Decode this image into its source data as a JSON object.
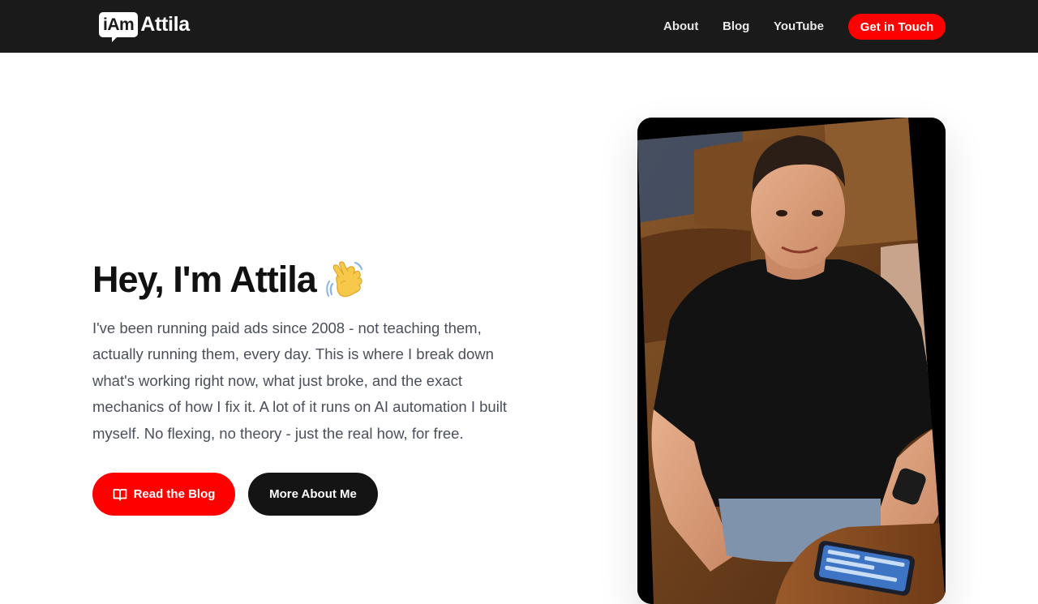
{
  "brand": {
    "logo_box_text": "iAm",
    "logo_word_text": "Attila"
  },
  "nav": {
    "links": [
      {
        "label": "About"
      },
      {
        "label": "Blog"
      },
      {
        "label": "YouTube"
      }
    ],
    "cta_label": "Get in Touch"
  },
  "hero": {
    "title": "Hey, I'm Attila",
    "wave_icon": "waving-hand-icon",
    "description": "I've been running paid ads since 2008 - not teaching them, actually running them, every day. This is where I break down what's working right now, what just broke, and the exact mechanics of how I fix it. A lot of it runs on AI automation I built myself. No flexing, no theory - just the real how, for free.",
    "primary_button": {
      "label": "Read the Blog",
      "icon": "book-open-icon"
    },
    "secondary_button": {
      "label": "More About Me"
    }
  },
  "colors": {
    "nav_background": "#1a1a1a",
    "accent": "#ff0000",
    "dark_button": "#141414",
    "heading": "#111111",
    "body_text": "#4a4f59"
  }
}
